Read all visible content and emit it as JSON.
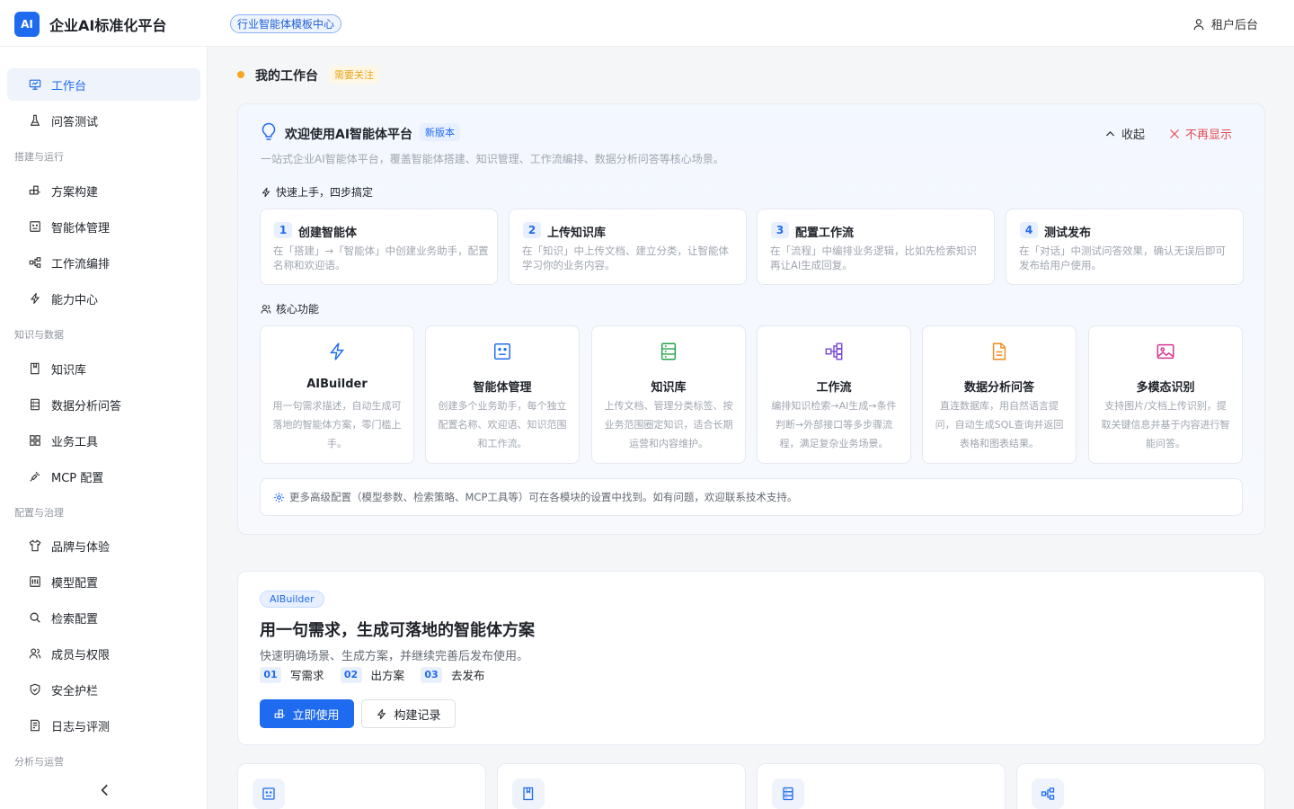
{
  "header": {
    "logo_text": "AI",
    "app_title": "企业AI标准化平台",
    "template_center": "行业智能体模板中心",
    "tenant_admin": "租户后台"
  },
  "sidebar": {
    "items": [
      {
        "label": "工作台",
        "icon": "monitor-icon",
        "active": true
      },
      {
        "label": "问答测试",
        "icon": "flask-icon"
      },
      {
        "group": "搭建与运行"
      },
      {
        "label": "方案构建",
        "icon": "blocks-icon"
      },
      {
        "label": "智能体管理",
        "icon": "robot-icon"
      },
      {
        "label": "工作流编排",
        "icon": "workflow-icon"
      },
      {
        "label": "能力中心",
        "icon": "bolt-icon"
      },
      {
        "group": "知识与数据"
      },
      {
        "label": "知识库",
        "icon": "book-icon"
      },
      {
        "label": "数据分析问答",
        "icon": "database-icon"
      },
      {
        "label": "业务工具",
        "icon": "grid-icon"
      },
      {
        "label": "MCP 配置",
        "icon": "plug-icon"
      },
      {
        "group": "配置与治理"
      },
      {
        "label": "品牌与体验",
        "icon": "shirt-icon"
      },
      {
        "label": "模型配置",
        "icon": "model-icon"
      },
      {
        "label": "检索配置",
        "icon": "search-icon"
      },
      {
        "label": "成员与权限",
        "icon": "users-icon"
      },
      {
        "label": "安全护栏",
        "icon": "shield-icon"
      },
      {
        "label": "日志与评测",
        "icon": "log-icon"
      },
      {
        "group": "分析与运营"
      }
    ]
  },
  "workspace": {
    "title": "我的工作台",
    "attention_badge": "需要关注"
  },
  "welcome": {
    "title": "欢迎使用AI智能体平台",
    "new_badge": "新版本",
    "collapse_label": "收起",
    "dismiss_label": "不再显示",
    "description": "一站式企业AI智能体平台，覆盖智能体搭建、知识管理、工作流编排、数据分析问答等核心场景。",
    "quickstart_label": "快速上手，四步搞定",
    "steps": [
      {
        "num": "1",
        "title": "创建智能体",
        "desc": "在「搭建」→「智能体」中创建业务助手，配置名称和欢迎语。"
      },
      {
        "num": "2",
        "title": "上传知识库",
        "desc": "在「知识」中上传文档、建立分类，让智能体学习你的业务内容。"
      },
      {
        "num": "3",
        "title": "配置工作流",
        "desc": "在「流程」中编排业务逻辑，比如先检索知识再让AI生成回复。"
      },
      {
        "num": "4",
        "title": "测试发布",
        "desc": "在「对话」中测试问答效果，确认无误后即可发布给用户使用。"
      }
    ],
    "core_label": "核心功能",
    "features": [
      {
        "title": "AIBuilder",
        "desc": "用一句需求描述，自动生成可落地的智能体方案，零门槛上手。",
        "icon": "bolt-icon",
        "color": "#1f6bf0"
      },
      {
        "title": "智能体管理",
        "desc": "创建多个业务助手，每个独立配置名称、欢迎语、知识范围和工作流。",
        "icon": "robot-icon",
        "color": "#1f6bf0"
      },
      {
        "title": "知识库",
        "desc": "上传文档、管理分类标签、按业务范围圈定知识，适合长期运营和内容维护。",
        "icon": "database-icon",
        "color": "#22a447"
      },
      {
        "title": "工作流",
        "desc": "编排知识检索→AI生成→条件判断→外部接口等多步骤流程，满足复杂业务场景。",
        "icon": "workflow-icon",
        "color": "#7c4ddb"
      },
      {
        "title": "数据分析问答",
        "desc": "直连数据库，用自然语言提问，自动生成SQL查询并返回表格和图表结果。",
        "icon": "file-icon",
        "color": "#f08c1f"
      },
      {
        "title": "多模态识别",
        "desc": "支持图片/文档上传识别，提取关键信息并基于内容进行智能问答。",
        "icon": "image-icon",
        "color": "#d9348f"
      }
    ],
    "tip": "更多高级配置（模型参数、检索策略、MCP工具等）可在各模块的设置中找到。如有问题，欢迎联系技术支持。"
  },
  "aibuilder": {
    "tag": "AIBuilder",
    "title": "用一句需求，生成可落地的智能体方案",
    "desc": "快速明确场景、生成方案，并继续完善后发布使用。",
    "steps": [
      {
        "num": "01",
        "label": "写需求"
      },
      {
        "num": "02",
        "label": "出方案"
      },
      {
        "num": "03",
        "label": "去发布"
      }
    ],
    "primary_btn": "立即使用",
    "secondary_btn": "构建记录"
  },
  "mini_cards": [
    {
      "icon": "robot-icon"
    },
    {
      "icon": "book-icon"
    },
    {
      "icon": "database-icon"
    },
    {
      "icon": "workflow-icon"
    }
  ]
}
